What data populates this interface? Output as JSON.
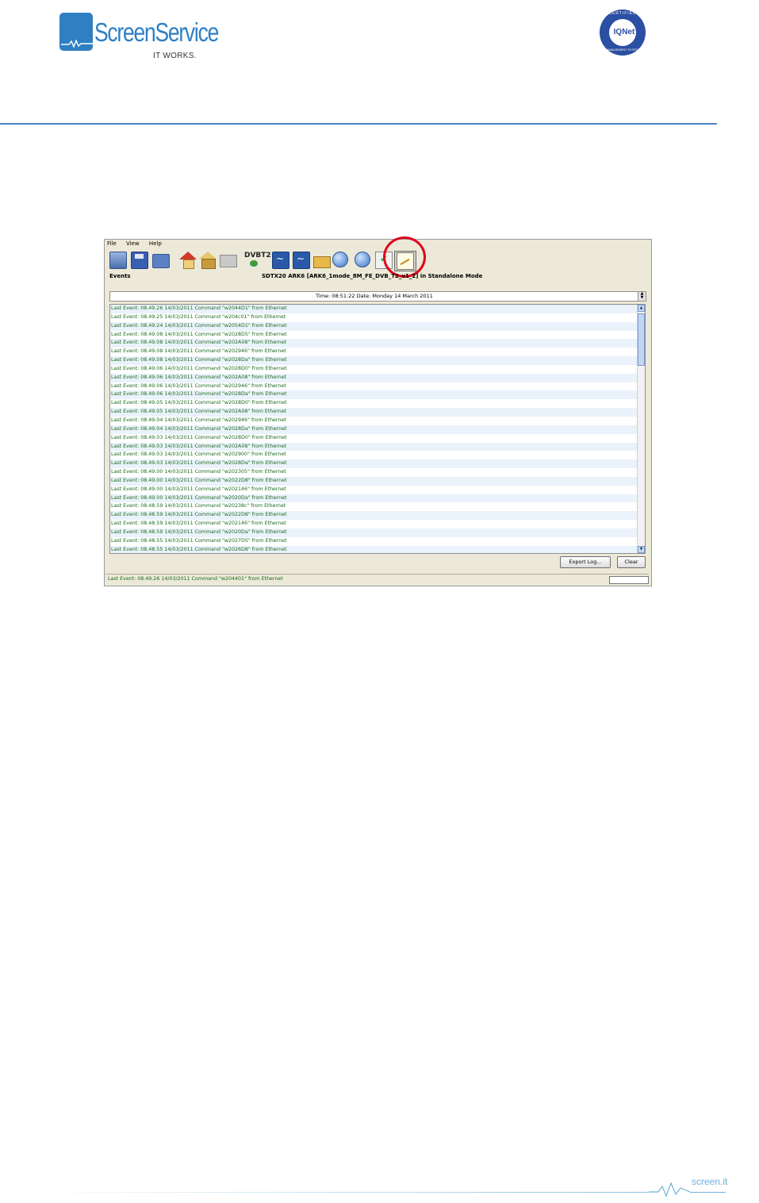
{
  "header": {
    "brand": "ScreenService",
    "tagline": "IT WORKS.",
    "cert_top": "CERTIFIED",
    "cert_name": "IQNet",
    "cert_bottom": "MANAGEMENT SYSTEM"
  },
  "window": {
    "menu": [
      "File",
      "View",
      "Help"
    ],
    "toolbar_icons": [
      "network-monitor-icon",
      "save-icon",
      "folder-icon",
      "home-icon",
      "box-icon",
      "grid-icon",
      "dvbt2-icon",
      "scope-icon",
      "scope-icon-2",
      "package-icon",
      "globe-network-icon",
      "internet-icon",
      "checklist-icon",
      "event-log-icon"
    ],
    "dvb_label": "DVBT2",
    "events_label": "Events",
    "device_title": "SDTX20 ARK6 [ARK6_1mode_8M_FE_DVB_T2_v1_2] in Standalone Mode",
    "time_date": "Time: 08:51:22  Date: Monday 14 March 2011",
    "log_rows": [
      "Last Event: 08.49.26 14/03/2011 Command \"w2044D1\" from Ethernet",
      "Last Event: 08.49.25 14/03/2011 Command \"w204c01\" from Ethernet",
      "Last Event: 08.49.24 14/03/2011 Command \"w2054D1\" from Ethernet",
      "Last Event: 08.49.08 14/03/2011 Command \"w2028D5\" from Ethernet",
      "Last Event: 08.49.08 14/03/2011 Command \"w202A08\" from Ethernet",
      "Last Event: 08.49.08 14/03/2011 Command \"w202946\" from Ethernet",
      "Last Event: 08.49.08 14/03/2011 Command \"w2028Da\" from Ethernet",
      "Last Event: 08.49.06 14/03/2011 Command \"w2028D0\" from Ethernet",
      "Last Event: 08.49.06 14/03/2011 Command \"w202A08\" from Ethernet",
      "Last Event: 08.49.06 14/03/2011 Command \"w202946\" from Ethernet",
      "Last Event: 08.49.06 14/03/2011 Command \"w2028Da\" from Ethernet",
      "Last Event: 08.49.05 14/03/2011 Command \"w2028D0\" from Ethernet",
      "Last Event: 08.49.05 14/03/2011 Command \"w202A08\" from Ethernet",
      "Last Event: 08.49.04 14/03/2011 Command \"w202946\" from Ethernet",
      "Last Event: 08.49.04 14/03/2011 Command \"w2028Da\" from Ethernet",
      "Last Event: 08.49.03 14/03/2011 Command \"w2028D0\" from Ethernet",
      "Last Event: 08.49.03 14/03/2011 Command \"w202A08\" from Ethernet",
      "Last Event: 08.49.03 14/03/2011 Command \"w202900\" from Ethernet",
      "Last Event: 08.49.03 14/03/2011 Command \"w2028Da\" from Ethernet",
      "Last Event: 08.49.00 14/03/2011 Command \"w202305\" from Ethernet",
      "Last Event: 08.49.00 14/03/2011 Command \"w2022D8\" from Ethernet",
      "Last Event: 08.49.00 14/03/2011 Command \"w202146\" from Ethernet",
      "Last Event: 08.49.00 14/03/2011 Command \"w2020Da\" from Ethernet",
      "Last Event: 08.48.59 14/03/2011 Command \"w20238c\" from Ethernet",
      "Last Event: 08.48.59 14/03/2011 Command \"w2022D8\" from Ethernet",
      "Last Event: 08.48.59 14/03/2011 Command \"w202146\" from Ethernet",
      "Last Event: 08.48.59 14/03/2011 Command \"w2020Da\" from Ethernet",
      "Last Event: 08.48.55 14/03/2011 Command \"w2027D5\" from Ethernet",
      "Last Event: 08.48.55 14/03/2011 Command \"w2026D8\" from Ethernet"
    ],
    "export_button": "Export Log...",
    "clear_button": "Clear",
    "status_text": "Last Event: 08.49.26 14/03/2011 Command \"w204401\" from Ethernet"
  },
  "footer": {
    "site": "screen.it"
  },
  "colors": {
    "brand_blue": "#2f7fc3",
    "log_text_green": "#1b6b1b",
    "highlight_red": "#e0001b"
  }
}
